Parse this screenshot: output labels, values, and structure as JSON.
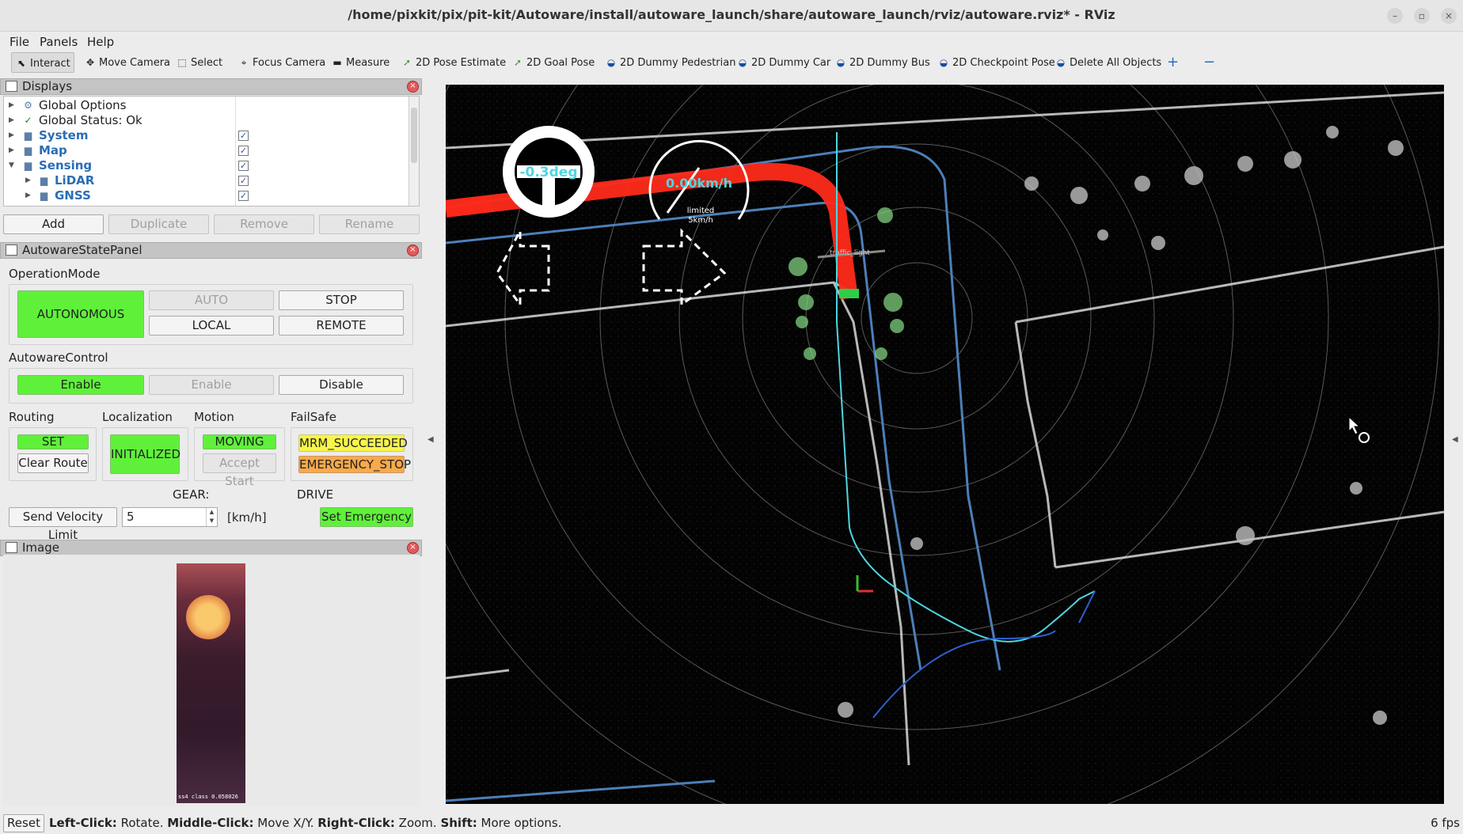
{
  "window": {
    "title": "/home/pixkit/pix/pit-kit/Autoware/install/autoware_launch/share/autoware_launch/rviz/autoware.rviz* - RViz"
  },
  "menu": [
    "File",
    "Panels",
    "Help"
  ],
  "toolbar": {
    "tools": [
      "Interact",
      "Move Camera",
      "Select",
      "Focus Camera",
      "Measure",
      "2D Pose Estimate",
      "2D Goal Pose",
      "2D Dummy Pedestrian",
      "2D Dummy Car",
      "2D Dummy Bus",
      "2D Checkpoint Pose",
      "Delete All Objects"
    ],
    "add_symbol": "+",
    "remove_symbol": "−"
  },
  "displays": {
    "title": "Displays",
    "items": [
      {
        "label": "Global Options",
        "icon": "gear-icon",
        "folder": false,
        "checked": null
      },
      {
        "label": "Global Status: Ok",
        "icon": "checkmark-icon",
        "folder": false,
        "checked": null
      },
      {
        "label": "System",
        "icon": "folder-icon",
        "folder": true,
        "checked": true
      },
      {
        "label": "Map",
        "icon": "folder-icon",
        "folder": true,
        "checked": true
      },
      {
        "label": "Sensing",
        "icon": "folder-icon",
        "folder": true,
        "checked": true
      },
      {
        "label": "LiDAR",
        "icon": "folder-icon",
        "folder": true,
        "checked": true
      },
      {
        "label": "GNSS",
        "icon": "folder-icon",
        "folder": true,
        "checked": true
      }
    ],
    "buttons": {
      "add": "Add",
      "duplicate": "Duplicate",
      "remove": "Remove",
      "rename": "Rename"
    }
  },
  "state_panel": {
    "title": "AutowareStatePanel",
    "operation_mode": {
      "label": "OperationMode",
      "current": "AUTONOMOUS",
      "auto": "AUTO",
      "stop": "STOP",
      "local": "LOCAL",
      "remote": "REMOTE"
    },
    "autoware_control": {
      "label": "AutowareControl",
      "status": "Enable",
      "enable": "Enable",
      "disable": "Disable"
    },
    "routing": {
      "label": "Routing",
      "status": "SET",
      "clear": "Clear Route"
    },
    "localization": {
      "label": "Localization",
      "status": "INITIALIZED"
    },
    "motion": {
      "label": "Motion",
      "status": "MOVING",
      "accept": "Accept Start"
    },
    "failsafe": {
      "label": "FailSafe",
      "mrm": "MRM_SUCCEEDED",
      "emergency": "EMERGENCY_STOP"
    },
    "gear": {
      "label": "GEAR:",
      "value": "DRIVE"
    },
    "velocity": {
      "button": "Send Velocity Limit",
      "value": "5",
      "unit": "[km/h]"
    },
    "set_emergency": "Set Emergency"
  },
  "image_panel": {
    "title": "Image",
    "caption": "ss4 class 0.058026"
  },
  "viewport": {
    "steering": "-0.3deg",
    "speed": "0.00km/h",
    "limit_label": "limited",
    "limit_value": "5km/h",
    "traffic_light_label": "traffic_light"
  },
  "statusbar": {
    "reset": "Reset",
    "hint_parts": [
      {
        "key": "Left-Click:",
        "text": " Rotate. "
      },
      {
        "key": "Middle-Click:",
        "text": " Move X/Y. "
      },
      {
        "key": "Right-Click:",
        "text": " Zoom. "
      },
      {
        "key": "Shift:",
        "text": " More options."
      }
    ],
    "fps": "6 fps"
  },
  "colors": {
    "path": "#ff2a1a",
    "lane_boundary": "#4d7fb8",
    "status_green": "#5ff13a",
    "status_yellow": "#f7f54a",
    "status_orange": "#f9a94a",
    "trajectory": "#4fd6e0"
  }
}
